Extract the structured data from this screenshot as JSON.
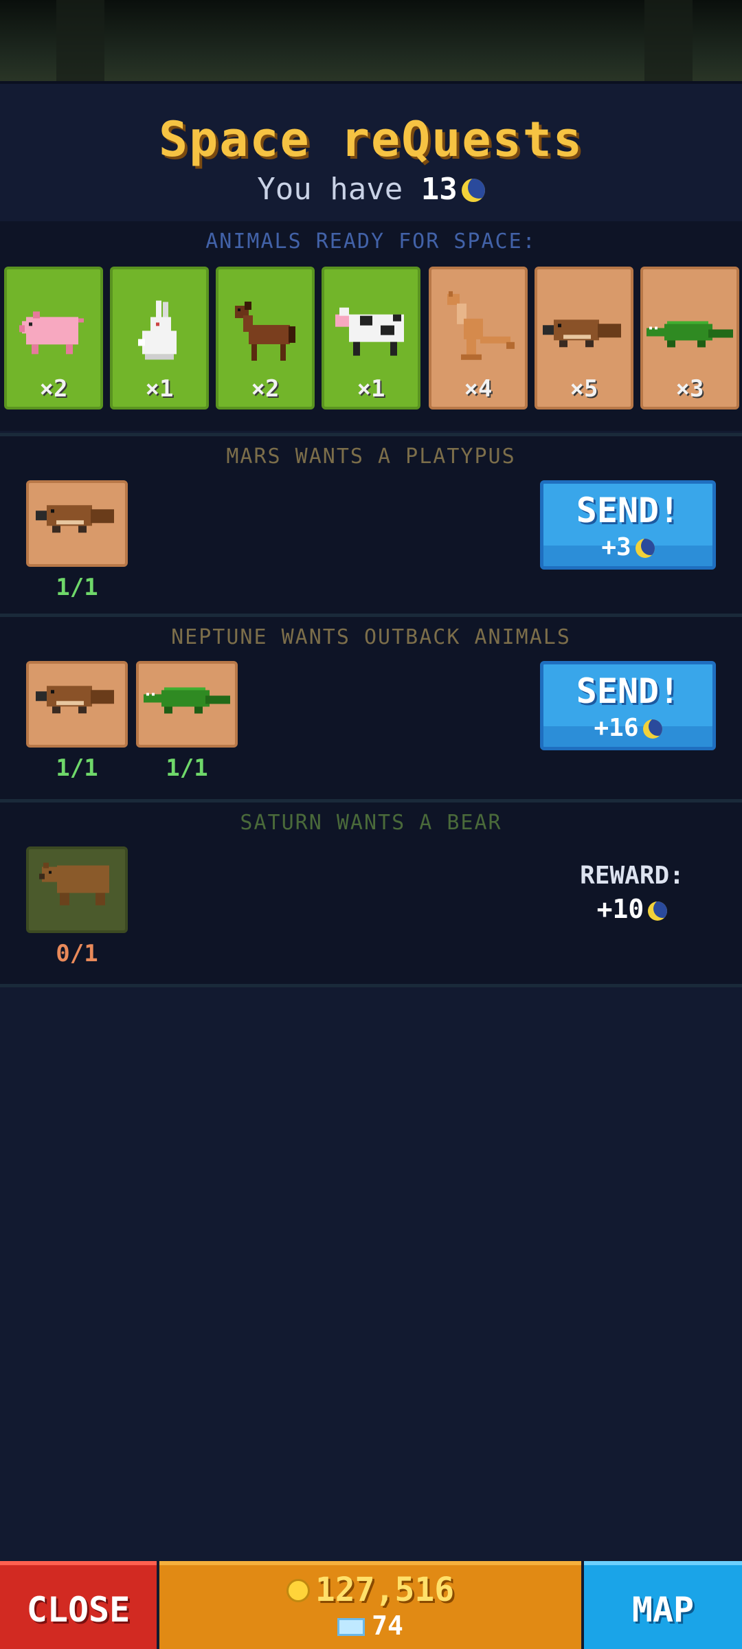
{
  "header": {
    "title": "Space reQuests",
    "coins_prefix": "You have",
    "coins_value": "13"
  },
  "ready": {
    "label": "ANIMALS READY FOR SPACE:",
    "animals": [
      {
        "name": "pig",
        "count": "×2"
      },
      {
        "name": "rabbit",
        "count": "×1"
      },
      {
        "name": "horse",
        "count": "×2"
      },
      {
        "name": "cow",
        "count": "×1"
      },
      {
        "name": "kangaroo",
        "count": "×4"
      },
      {
        "name": "platypus",
        "count": "×5"
      },
      {
        "name": "crocodile",
        "count": "×3"
      }
    ]
  },
  "requests": [
    {
      "title": "MARS WANTS A PLATYPUS",
      "items": [
        {
          "animal": "platypus",
          "progress": "1/1"
        }
      ],
      "button": "SEND!",
      "amount": "+3"
    },
    {
      "title": "NEPTUNE WANTS OUTBACK ANIMALS",
      "items": [
        {
          "animal": "platypus",
          "progress": "1/1"
        },
        {
          "animal": "crocodile",
          "progress": "1/1"
        }
      ],
      "button": "SEND!",
      "amount": "+16"
    },
    {
      "title": "SATURN WANTS A BEAR",
      "items": [
        {
          "animal": "bear",
          "progress": "0/1"
        }
      ],
      "reward_label": "REWARD:",
      "amount": "+10"
    }
  ],
  "bottom": {
    "close": "CLOSE",
    "gold": "127,516",
    "gems": "74",
    "map": "MAP"
  },
  "colors": {
    "title": "#f6c343",
    "send_button": "#39a6ea",
    "close_button": "#d22a22",
    "money_bar": "#e18a14",
    "map_button": "#1aa4e8"
  }
}
